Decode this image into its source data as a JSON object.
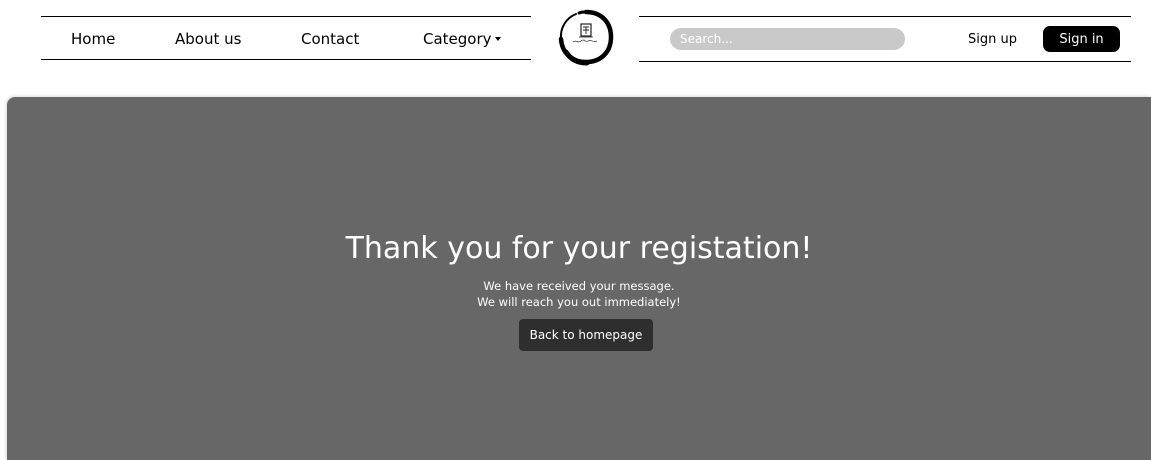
{
  "nav": {
    "home": "Home",
    "about": "About us",
    "contact": "Contact",
    "category": "Category",
    "search_placeholder": "Search...",
    "signup": "Sign up",
    "signin": "Sign in"
  },
  "hero": {
    "title": "Thank you for your registation!",
    "line1": "We have received your message.",
    "line2": "We will reach you out immediately!",
    "button": "Back to homepage"
  },
  "colors": {
    "hero_bg": "#676767",
    "button_bg": "#2e2e2e",
    "signin_bg": "#000000",
    "search_bg": "#c9c9c9"
  }
}
